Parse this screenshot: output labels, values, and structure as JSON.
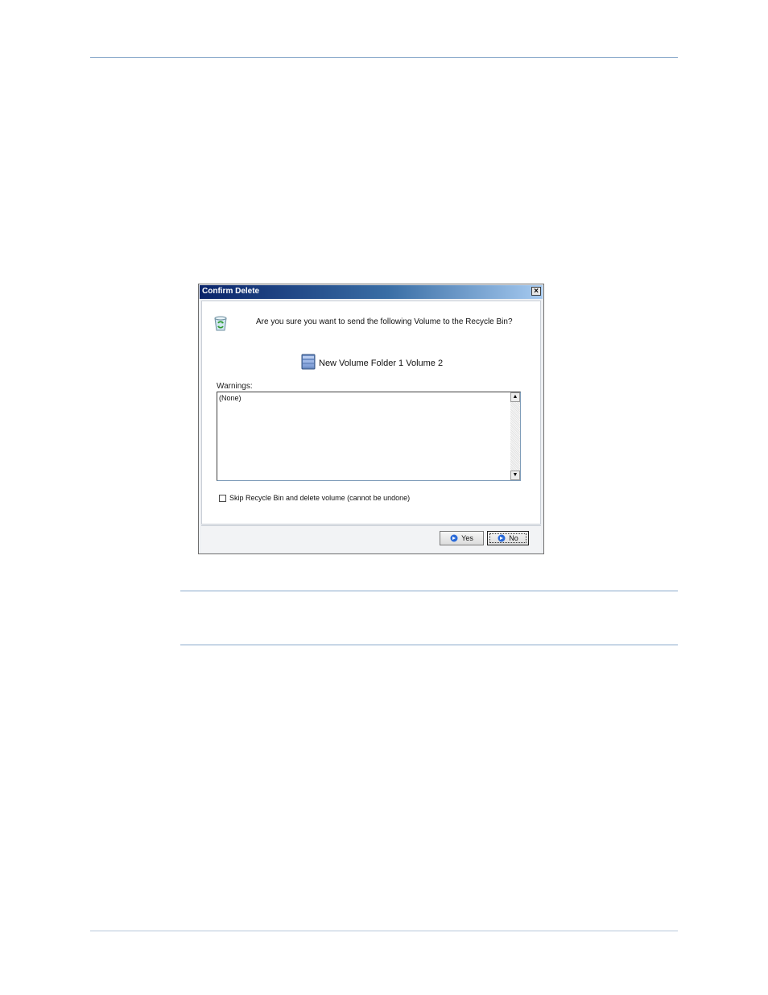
{
  "dialog": {
    "title": "Confirm Delete",
    "close_glyph": "×",
    "question": "Are you sure you want to send the following Volume to the Recycle Bin?",
    "volume_name": "New Volume Folder 1 Volume 2",
    "warnings_label": "Warnings:",
    "warnings_text": "(None)",
    "skip_checkbox_label": "Skip Recycle Bin and delete volume (cannot be undone)",
    "skip_checked": false,
    "yes_label": "Yes",
    "no_label": "No",
    "scroll_up_glyph": "▲",
    "scroll_down_glyph": "▼"
  },
  "icons": {
    "recycle": "recycle-bin-icon",
    "volume": "volume-icon",
    "button_arrow": "arrow-right-icon"
  },
  "colors": {
    "rule": "#8aaacb",
    "titlebar_start": "#0a246a",
    "titlebar_end": "#a6caf0",
    "button_arrow": "#2a6ad8"
  }
}
